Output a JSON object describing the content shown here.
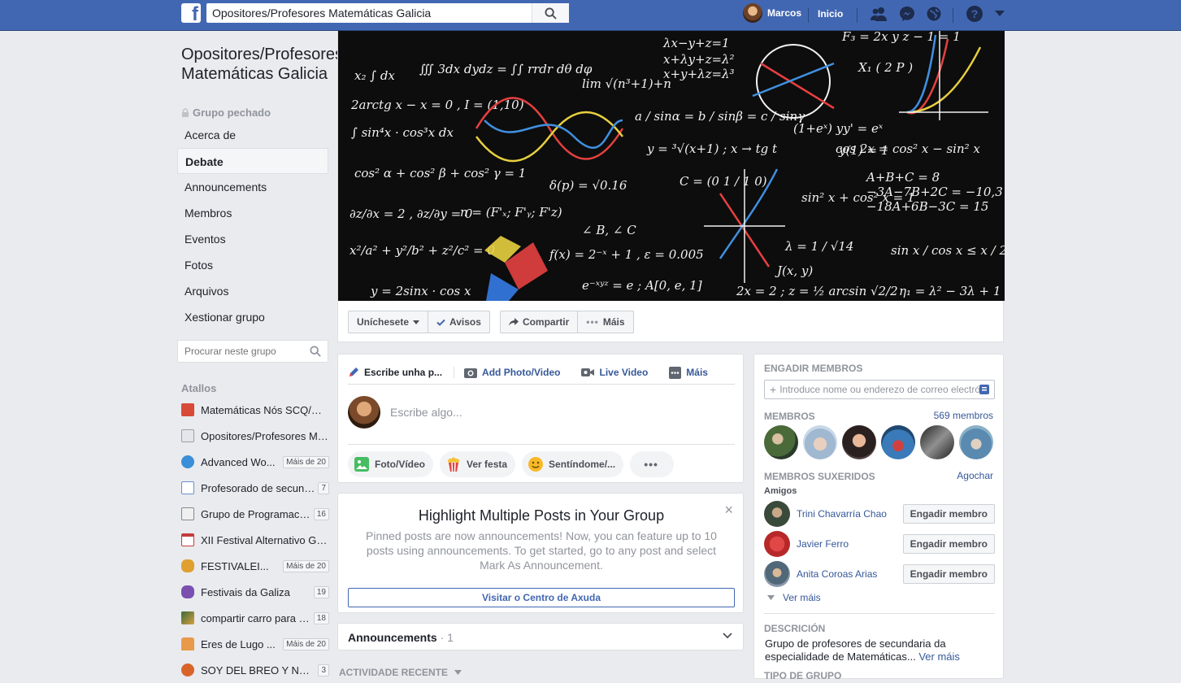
{
  "topbar": {
    "logo": "f",
    "search_value": "Opositores/Profesores Matemáticas Galicia",
    "user_name": "Marcos",
    "home_label": "Inicio",
    "icons": [
      "friend-requests-icon",
      "messenger-icon",
      "notifications-globe-icon",
      "help-icon",
      "account-menu-icon"
    ]
  },
  "group": {
    "title": "Opositores/Profesores Matemáticas Galicia",
    "privacy": "Grupo pechado"
  },
  "nav": [
    {
      "label": "Acerca de",
      "active": false
    },
    {
      "label": "Debate",
      "active": true
    },
    {
      "label": "Announcements",
      "active": false
    },
    {
      "label": "Membros",
      "active": false
    },
    {
      "label": "Eventos",
      "active": false
    },
    {
      "label": "Fotos",
      "active": false
    },
    {
      "label": "Arquivos",
      "active": false
    },
    {
      "label": "Xestionar grupo",
      "active": false
    }
  ],
  "group_search": {
    "placeholder": "Procurar neste grupo"
  },
  "shortcuts": {
    "title": "Atallos",
    "items": [
      {
        "label": "Matemáticas Nós SCQ/Matemáticas...",
        "badge": "",
        "color": "#d84a38"
      },
      {
        "label": "Opositores/Profesores Matemáticas Galicia",
        "badge": "",
        "color": "#9aa0a8"
      },
      {
        "label": "Advanced Wo...",
        "badge": "Máis de 20",
        "color": "#3a8fd8"
      },
      {
        "label": "Profesorado de secundaria",
        "badge": "7",
        "color": "#6b8fc8"
      },
      {
        "label": "Grupo de Programación",
        "badge": "16",
        "color": "#e6e6e6"
      },
      {
        "label": "XII Festival Alternativo Galego",
        "badge": "",
        "color": "#c43c3c"
      },
      {
        "label": "FESTIVALEI...",
        "badge": "Máis de 20",
        "color": "#e0a030"
      },
      {
        "label": "Festivais da Galiza",
        "badge": "19",
        "color": "#7a4fb0"
      },
      {
        "label": "compartir carro para festivais",
        "badge": "18",
        "color": "#3a6b3a"
      },
      {
        "label": "Eres de Lugo ...",
        "badge": "Máis de 20",
        "color": "#e89a4a"
      },
      {
        "label": "SOY DEL BREO Y NO ME MUERO",
        "badge": "3",
        "color": "#d8642a"
      }
    ]
  },
  "cover_actions": [
    {
      "label": "Uníchesete",
      "icon": "dropdown-caret-icon"
    },
    {
      "label": "Avisos",
      "icon": "check-icon"
    },
    {
      "label": "Compartir",
      "icon": "share-arrow-icon"
    },
    {
      "label": "Máis",
      "icon": "more-dots-icon"
    }
  ],
  "composer": {
    "tabs": [
      "Escribe unha p...",
      "Add Photo/Video",
      "Live Video",
      "Máis"
    ],
    "placeholder": "Escribe algo...",
    "pills": [
      "Foto/Vídeo",
      "Ver festa",
      "Sentíndome/..."
    ]
  },
  "highlight": {
    "title": "Highlight Multiple Posts in Your Group",
    "body": "Pinned posts are now announcements! Now, you can feature up to 10 posts using announcements. To get started, go to any post and select Mark As Announcement.",
    "button": "Visitar o Centro de Axuda",
    "close": "×"
  },
  "announcements": {
    "title": "Announcements",
    "count": "· 1"
  },
  "recent": {
    "label": "ACTIVIDADE RECENTE"
  },
  "right": {
    "add_title": "ENGADIR MEMBROS",
    "add_placeholder": "Introduce nome ou enderezo de correo electrónico...",
    "members_title": "MEMBROS",
    "members_count": "569 membros",
    "suggested_title": "MEMBROS SUXERIDOS",
    "hide": "Agochar",
    "friends": "Amigos",
    "suggestions": [
      {
        "name": "Trini Chavarría Chao",
        "button": "Engadir membro"
      },
      {
        "name": "Javier Ferro",
        "button": "Engadir membro"
      },
      {
        "name": "Anita Coroas Arias",
        "button": "Engadir membro"
      }
    ],
    "see_more": "Ver máis",
    "desc_title": "DESCRICIÓN",
    "description": "Grupo de profesores de secundaria da especialidade de Matemáticas...",
    "desc_more": "Ver máis",
    "type_title": "TIPO DE GRUPO"
  }
}
